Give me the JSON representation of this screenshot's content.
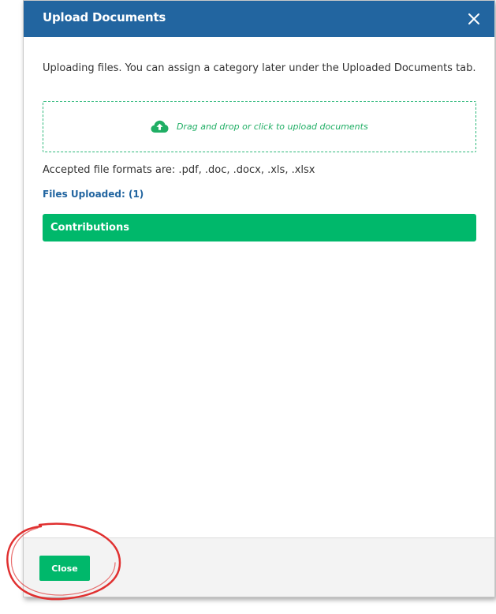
{
  "dialog": {
    "title": "Upload Documents",
    "intro": "Uploading files. You can assign a category later under the Uploaded Documents tab.",
    "dropzone_text": "Drag and drop or click to upload documents",
    "accepted_formats": "Accepted file formats are: .pdf, .doc, .docx, .xls, .xlsx",
    "files_uploaded": "Files Uploaded: (1)",
    "files": [
      {
        "category": "Contributions"
      }
    ],
    "close_label": "Close"
  },
  "colors": {
    "header": "#2265a0",
    "accent_green": "#00b86b",
    "annotation_red": "#e03030"
  },
  "icons": {
    "close": "close-icon",
    "upload": "cloud-upload-icon"
  }
}
